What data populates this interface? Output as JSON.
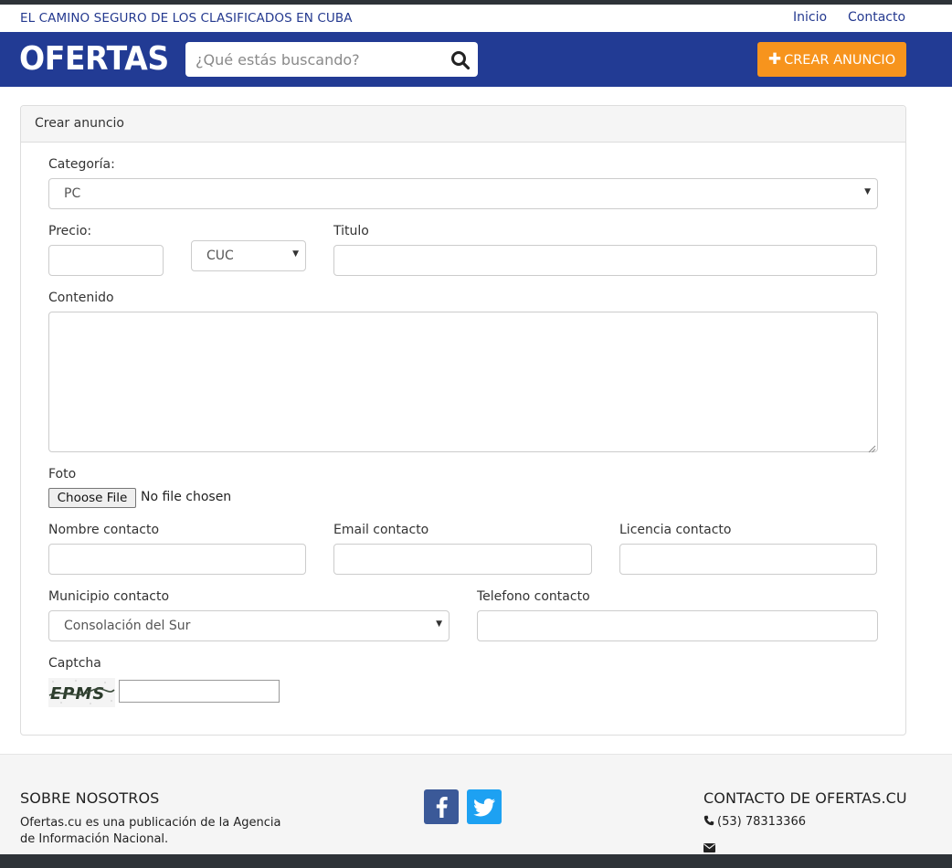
{
  "topbar": {
    "tagline": "EL CAMINO SEGURO DE LOS CLASIFICADOS EN CUBA",
    "links": [
      {
        "label": "Inicio"
      },
      {
        "label": "Contacto"
      }
    ]
  },
  "header": {
    "logo": "OFERTAS",
    "search_placeholder": "¿Qué estás buscando?",
    "create_label": "CREAR ANUNCIO"
  },
  "form": {
    "title": "Crear anuncio",
    "categoria_label": "Categoría:",
    "categoria_value": "PC",
    "precio_label": "Precio:",
    "currency_value": "CUC",
    "titulo_label": "Titulo",
    "contenido_label": "Contenido",
    "foto_label": "Foto",
    "file_button": "Choose File",
    "file_status": "No file chosen",
    "nombre_label": "Nombre contacto",
    "email_label": "Email contacto",
    "licencia_label": "Licencia contacto",
    "municipio_label": "Municipio contacto",
    "municipio_value": "Consolación del Sur",
    "telefono_label": "Telefono contacto",
    "captcha_label": "Captcha",
    "captcha_text": "EPMS"
  },
  "footer": {
    "about_title": "SOBRE NOSOTROS",
    "about_text": "Ofertas.cu es una publicación de la Agencia de Información Nacional.",
    "contact_title": "CONTACTO DE OFERTAS.CU",
    "phone": "(53) 78313366"
  },
  "colors": {
    "header_bg": "#223b94",
    "accent_orange": "#f7941d",
    "facebook": "#3b5998",
    "twitter": "#1da1f2"
  },
  "icons": [
    "search-icon",
    "plus-icon",
    "facebook-icon",
    "twitter-icon",
    "phone-icon",
    "envelope-icon",
    "caret-down-icon"
  ]
}
